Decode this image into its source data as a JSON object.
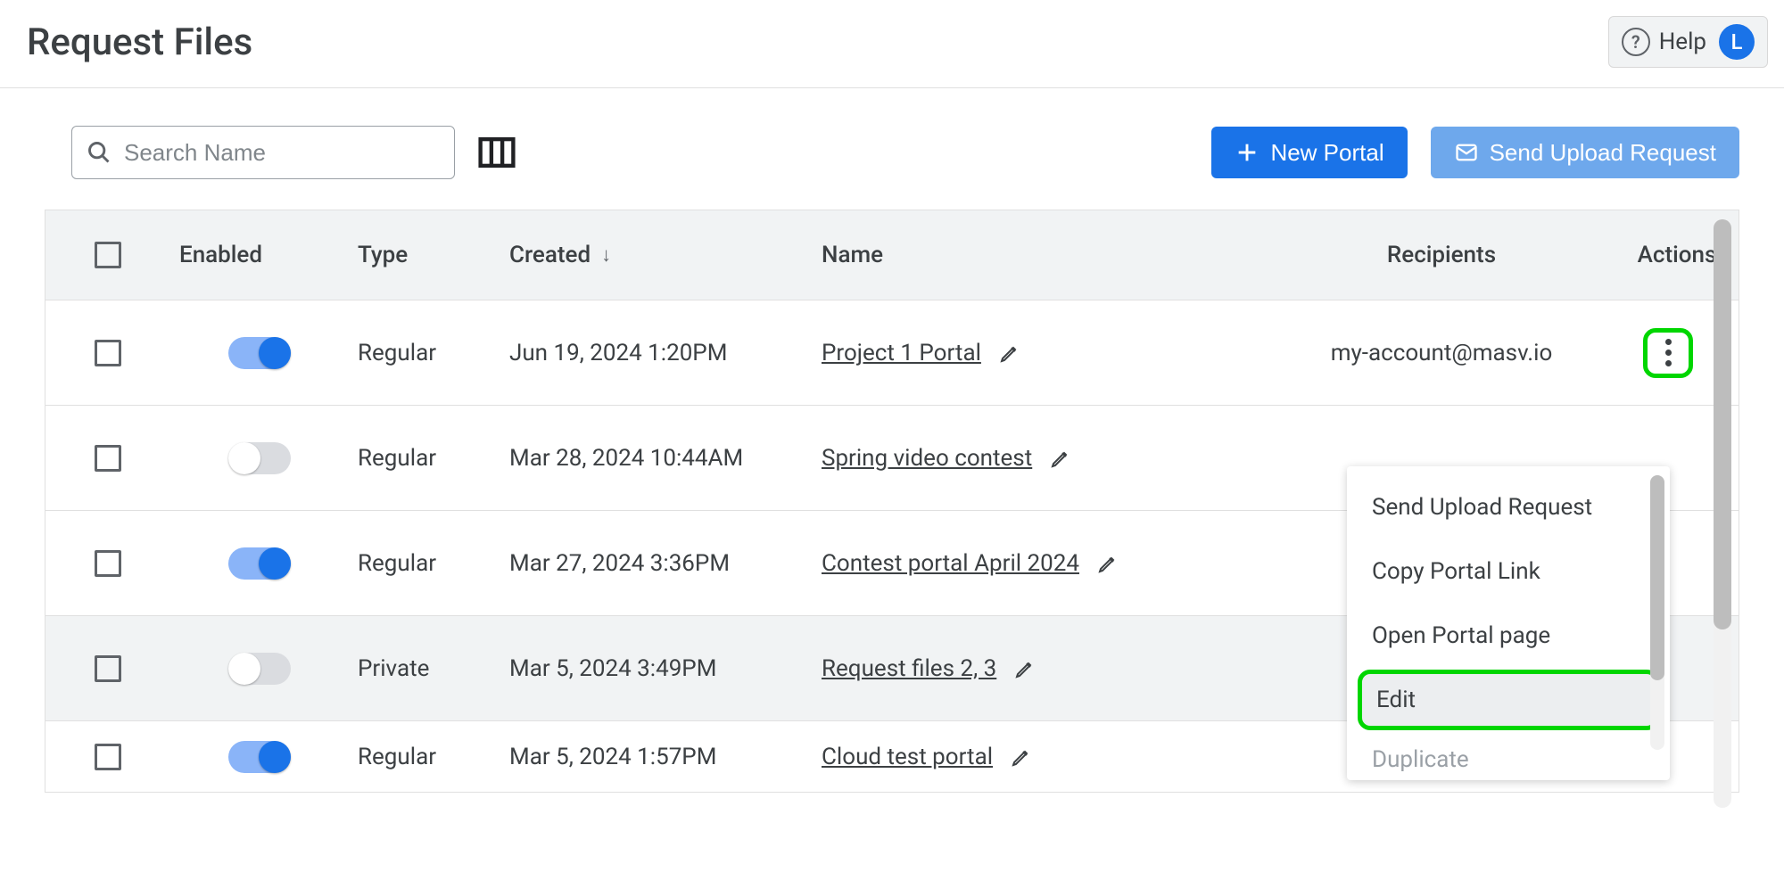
{
  "header": {
    "title": "Request Files",
    "help_label": "Help",
    "avatar_letter": "L"
  },
  "toolbar": {
    "search_placeholder": "Search Name",
    "new_portal_label": "New Portal",
    "send_request_label": "Send Upload Request"
  },
  "columns": {
    "enabled": "Enabled",
    "type": "Type",
    "created": "Created",
    "name": "Name",
    "recipients": "Recipients",
    "actions": "Actions"
  },
  "rows": [
    {
      "enabled": true,
      "type": "Regular",
      "created": "Jun 19, 2024 1:20PM",
      "name": "Project 1 Portal",
      "recipients": "my-account@masv.io"
    },
    {
      "enabled": false,
      "type": "Regular",
      "created": "Mar 28, 2024 10:44AM",
      "name": "Spring video contest",
      "recipients": ""
    },
    {
      "enabled": true,
      "type": "Regular",
      "created": "Mar 27, 2024 3:36PM",
      "name": "Contest portal April 2024",
      "recipients": ""
    },
    {
      "enabled": false,
      "type": "Private",
      "created": "Mar 5, 2024 3:49PM",
      "name": "Request files 2, 3",
      "recipients": ""
    },
    {
      "enabled": true,
      "type": "Regular",
      "created": "Mar 5, 2024 1:57PM",
      "name": "Cloud test portal",
      "recipients": ""
    }
  ],
  "menu": {
    "items": [
      "Send Upload Request",
      "Copy Portal Link",
      "Open Portal page",
      "Edit",
      "Duplicate"
    ]
  }
}
